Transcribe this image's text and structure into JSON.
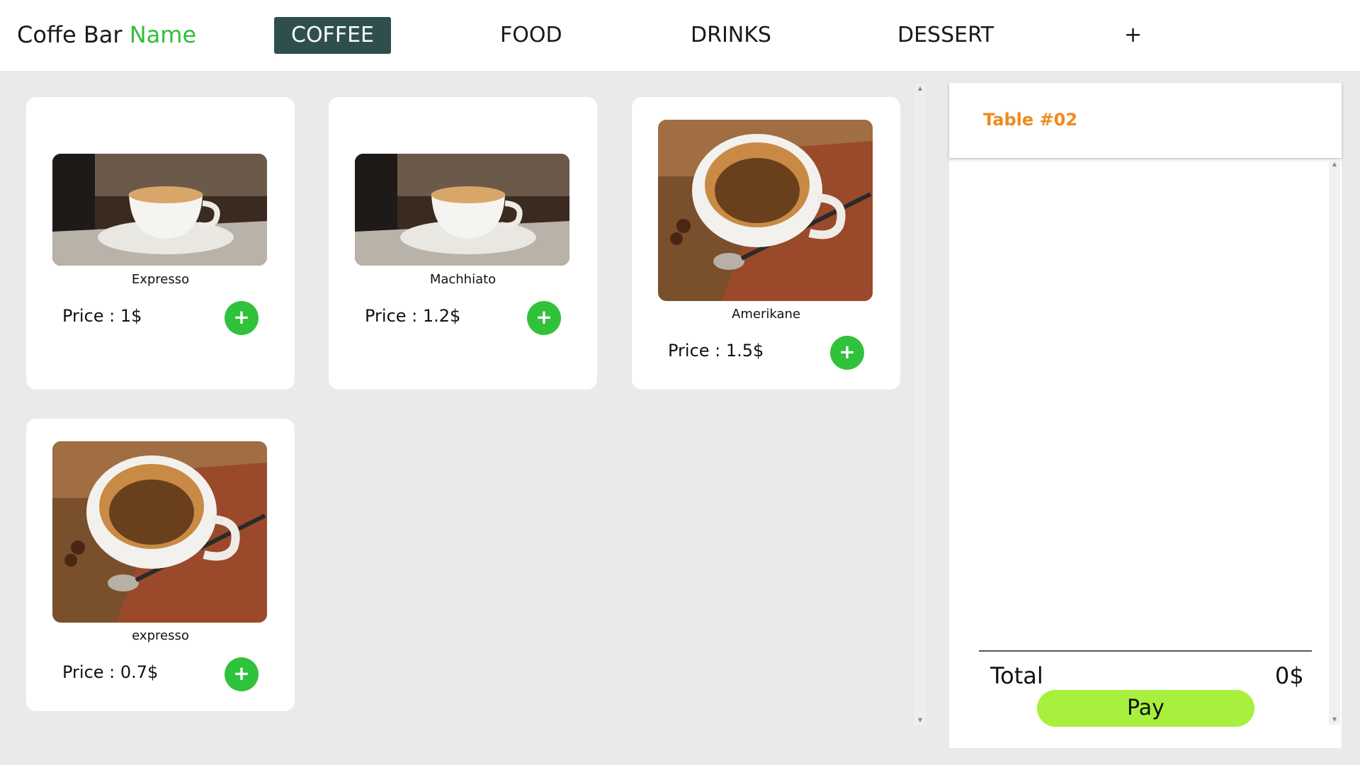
{
  "header": {
    "brand_text": "Coffe Bar ",
    "brand_accent": "Name",
    "tabs": [
      {
        "label": "COFFEE",
        "active": true
      },
      {
        "label": "FOOD",
        "active": false
      },
      {
        "label": "DRINKS",
        "active": false
      },
      {
        "label": "DESSERT",
        "active": false
      },
      {
        "label": "+",
        "active": false
      }
    ]
  },
  "products": [
    {
      "name": "Expresso",
      "price": "Price : 1$",
      "image": "espresso-cup-on-saucer-photo"
    },
    {
      "name": "Machhiato",
      "price": "Price : 1.2$",
      "image": "espresso-cup-on-saucer-photo"
    },
    {
      "name": "Amerikane",
      "price": "Price : 1.5$",
      "image": "coffee-cup-with-spoon-photo"
    },
    {
      "name": "expresso",
      "price": "Price : 0.7$",
      "image": "coffee-cup-with-spoon-photo"
    }
  ],
  "add_button_symbol": "+",
  "order": {
    "table_label": "Table #02",
    "total_label": "Total",
    "total_value": "0$",
    "pay_label": "Pay"
  },
  "colors": {
    "brand_accent": "#2fbf3a",
    "active_tab_bg": "#2f4f4f",
    "add_button": "#2fc23a",
    "table_label": "#ef8a1e",
    "pay_button": "#a7f03d"
  }
}
